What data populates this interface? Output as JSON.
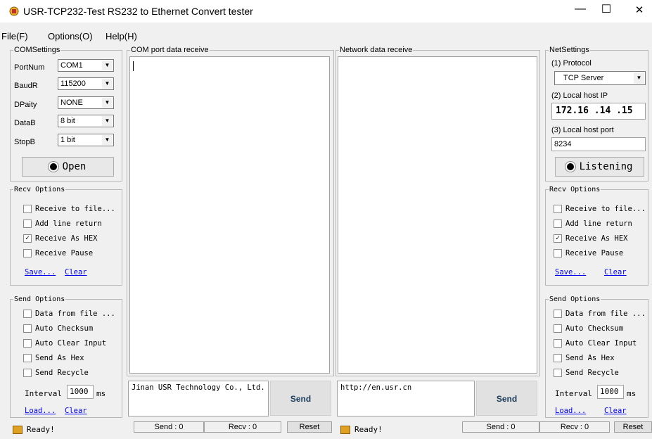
{
  "window": {
    "title": "USR-TCP232-Test  RS232 to Ethernet Convert tester",
    "minimize": "—",
    "maximize": "☐",
    "close": "✕"
  },
  "menu": [
    "File(F)",
    "Options(O)",
    "Help(H)"
  ],
  "com_settings": {
    "legend": "COMSettings",
    "fields": [
      {
        "label": "PortNum",
        "value": "COM1"
      },
      {
        "label": "BaudR",
        "value": "115200"
      },
      {
        "label": "DPaity",
        "value": "NONE"
      },
      {
        "label": "DataB",
        "value": "8 bit"
      },
      {
        "label": "StopB",
        "value": "1 bit"
      }
    ],
    "open_label": "Open"
  },
  "left_recv": {
    "legend": "Recv Options",
    "options": [
      {
        "label": "Receive to file...",
        "checked": false
      },
      {
        "label": "Add line return",
        "checked": false
      },
      {
        "label": "Receive As HEX",
        "checked": true
      },
      {
        "label": "Receive Pause",
        "checked": false
      }
    ],
    "save": "Save...",
    "clear": "Clear"
  },
  "left_send": {
    "legend": "Send Options",
    "options": [
      {
        "label": "Data from file ...",
        "checked": false
      },
      {
        "label": "Auto Checksum",
        "checked": false
      },
      {
        "label": "Auto Clear Input",
        "checked": false
      },
      {
        "label": "Send As Hex",
        "checked": false
      },
      {
        "label": "Send Recycle",
        "checked": false
      }
    ],
    "interval_label": "Interval",
    "interval_value": "1000",
    "interval_unit": "ms",
    "load": "Load...",
    "clear": "Clear"
  },
  "com_receive": {
    "legend": "COM port data receive",
    "send_text": "Jinan USR Technology Co., Ltd.",
    "send_label": "Send"
  },
  "net_receive": {
    "legend": "Network data receive",
    "send_text": "http://en.usr.cn",
    "send_label": "Send"
  },
  "net_settings": {
    "legend": "NetSettings",
    "protocol_label": "(1) Protocol",
    "protocol_value": "TCP Server",
    "ip_label": "(2) Local host IP",
    "ip_value": "172.16 .14 .15",
    "port_label": "(3) Local host port",
    "port_value": "8234",
    "listen_label": "Listening"
  },
  "right_recv": {
    "legend": "Recv Options",
    "options": [
      {
        "label": "Receive to file...",
        "checked": false
      },
      {
        "label": "Add line return",
        "checked": false
      },
      {
        "label": "Receive As HEX",
        "checked": true
      },
      {
        "label": "Receive Pause",
        "checked": false
      }
    ],
    "save": "Save...",
    "clear": "Clear"
  },
  "right_send": {
    "legend": "Send Options",
    "options": [
      {
        "label": "Data from file ...",
        "checked": false
      },
      {
        "label": "Auto Checksum",
        "checked": false
      },
      {
        "label": "Auto Clear Input",
        "checked": false
      },
      {
        "label": "Send As Hex",
        "checked": false
      },
      {
        "label": "Send Recycle",
        "checked": false
      }
    ],
    "interval_label": "Interval",
    "interval_value": "1000",
    "interval_unit": "ms",
    "load": "Load...",
    "clear": "Clear"
  },
  "status": {
    "ready_left": "Ready!",
    "com_send": "Send : 0",
    "com_recv": "Recv : 0",
    "com_reset": "Reset",
    "ready_mid": "Ready!",
    "net_send": "Send : 0",
    "net_recv": "Recv : 0",
    "net_reset": "Reset"
  }
}
